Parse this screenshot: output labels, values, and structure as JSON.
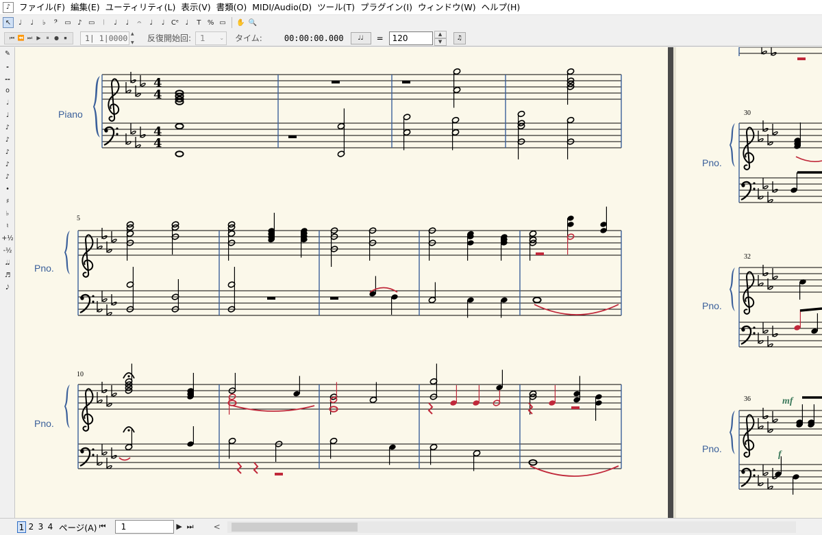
{
  "menubar": {
    "app_icon": "music-note-doc-icon",
    "items": [
      "ファイル(F)",
      "編集(E)",
      "ユーティリティ(L)",
      "表示(V)",
      "書類(O)",
      "MIDI/Audio(D)",
      "ツール(T)",
      "プラグイン(I)",
      "ウィンドウ(W)",
      "ヘルプ(H)"
    ]
  },
  "tools": {
    "glyphs": [
      "↖",
      "♩",
      "♩",
      "♭",
      "𝄢",
      "▭",
      "♪",
      "▭",
      "𝄀",
      "♩",
      "♩",
      "𝄐",
      "♩",
      "♩",
      "Cᵉ",
      "♩",
      "T",
      "%",
      "▭",
      "✋",
      "🔍"
    ],
    "icons": [
      "select-arrow-icon",
      "note-entry-icon",
      "chord-tool-icon",
      "key-signature-icon",
      "clef-icon",
      "staff-tool-icon",
      "note-tool-icon",
      "measure-tool-icon",
      "repeat-tool-icon",
      "tuplet-tool-icon",
      "smart-shape-icon",
      "articulation-icon",
      "expression-icon",
      "lyric-tool-icon",
      "chord-symbol-icon",
      "mirror-tool-icon",
      "text-tool-icon",
      "resize-tool-icon",
      "page-layout-icon",
      "hand-grabber-icon",
      "zoom-icon"
    ]
  },
  "transport": {
    "buttons": [
      "⏮",
      "⏪",
      "⏭",
      "▶",
      "⏸",
      "●",
      "⏹"
    ],
    "position": "1| 1|0000",
    "repeat_label": "反復開始回:",
    "repeat_value": "1",
    "time_label": "タイム:",
    "time_value": "00:00:00.000",
    "tempo_unit": "♩♩",
    "equals": "=",
    "tempo_value": "120"
  },
  "palette": {
    "glyphs": [
      "✎",
      "𝅝",
      "𝅝𝅝",
      "o",
      "𝅗𝅥",
      "♩",
      "♪",
      "♪",
      "♪",
      "♪",
      "♪",
      "•",
      "♯",
      "♭",
      "♮",
      "+½",
      "-½",
      "𝅘𝅥𝅘𝅥",
      "♬",
      "𝅘𝅥𝅮"
    ]
  },
  "score": {
    "instrument_full": "Piano",
    "instrument_abbr": "Pno.",
    "measure_numbers": [
      "5",
      "10",
      "30",
      "32",
      "36"
    ],
    "dynamics": [
      "mf",
      "f"
    ],
    "colors": {
      "ink": "#000000",
      "staff_blue": "#3a5f9a",
      "layer_red": "#c0283a",
      "dynamic_green": "#3c7a5c",
      "paper": "#fbf8ea"
    }
  },
  "bottombar": {
    "page_tabs": [
      "1",
      "2",
      "3",
      "4"
    ],
    "active_tab": "1",
    "page_label": "ページ(A)",
    "page_value": "1",
    "scroll_left": "<"
  }
}
